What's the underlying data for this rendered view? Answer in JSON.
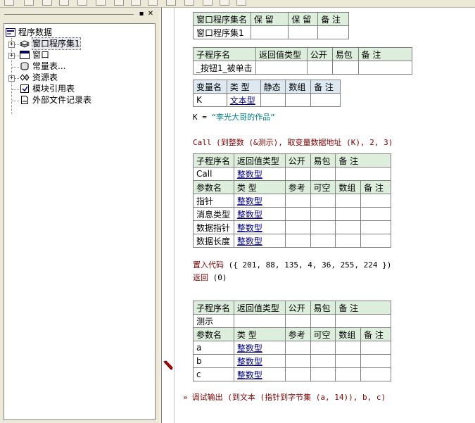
{
  "tree": {
    "root": "程序数据",
    "items": [
      "窗口程序集1",
      "窗口",
      "常量表...",
      "资源表",
      "模块引用表",
      "外部文件记录表"
    ]
  },
  "pane_buttons": {
    "pin": "▪",
    "close": "✕"
  },
  "assembly_table": {
    "headers": [
      "窗口程序集名",
      "保 留",
      "保 留",
      "备 注"
    ],
    "row": [
      "窗口程序集1",
      "",
      "",
      ""
    ]
  },
  "sub1": {
    "headers": [
      "子程序名",
      "返回值类型",
      "公开",
      "易包",
      "备 注"
    ],
    "row": [
      "_按钮1_被单击",
      "",
      "",
      "",
      ""
    ]
  },
  "var_table": {
    "headers": [
      "变量名",
      "类 型",
      "静态",
      "数组",
      "备 注"
    ],
    "row": [
      "K",
      "文本型",
      "",
      "",
      ""
    ]
  },
  "code": {
    "line1_var": "K = ",
    "line1_str": "“李光大哥的作品”",
    "line2_cmd": "Call (到整数 (&测示), 取变量数据地址 (K), 2, 3)"
  },
  "call_sub": {
    "headers": [
      "子程序名",
      "返回值类型",
      "公开",
      "易包",
      "备 注"
    ],
    "row": [
      "Call",
      "整数型",
      "",
      "",
      ""
    ],
    "param_headers": [
      "参数名",
      "类 型",
      "参考",
      "可空",
      "数组",
      "备 注"
    ],
    "params": [
      {
        "name": "指针",
        "type": "整数型"
      },
      {
        "name": "消息类型",
        "type": "整数型"
      },
      {
        "name": "数据指针",
        "type": "整数型"
      },
      {
        "name": "数据长度",
        "type": "整数型"
      }
    ]
  },
  "code2": {
    "line1_cmd": "置入代码",
    "line1_rest": " ({ 201, 88, 135, 4, 36, 255, 224 })",
    "line2_cmd": "返回",
    "line2_rest": " (0)"
  },
  "test_sub": {
    "headers": [
      "子程序名",
      "返回值类型",
      "公开",
      "易包",
      "备 注"
    ],
    "row": [
      "测示",
      "",
      "",
      "",
      ""
    ],
    "param_headers": [
      "参数名",
      "类 型",
      "参考",
      "可空",
      "数组",
      "备 注"
    ],
    "params": [
      {
        "name": "a",
        "type": "整数型"
      },
      {
        "name": "b",
        "type": "整数型"
      },
      {
        "name": "c",
        "type": "整数型"
      }
    ]
  },
  "code3": {
    "arrow": "»",
    "line1_cmd": "调试输出 (到文本 (指针到字节集 (a, 14)), b, c)"
  },
  "colors": {
    "header_green": "#ddeedd",
    "header_blue": "#dde8f0",
    "type_link": "#000080",
    "command": "#800000",
    "string": "#008080"
  }
}
